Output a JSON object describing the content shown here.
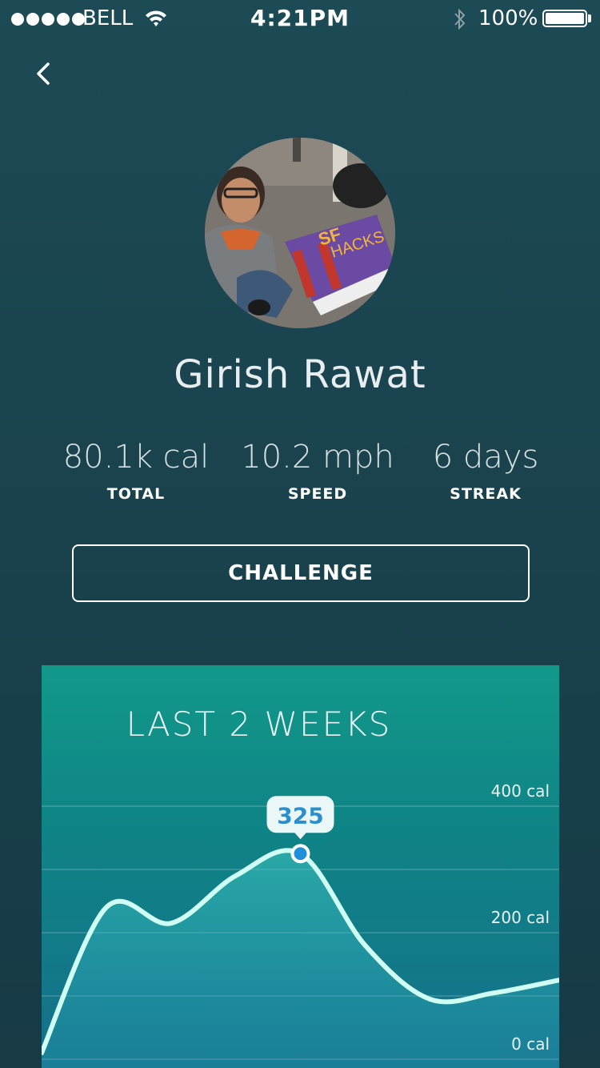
{
  "status_bar": {
    "carrier": "BELL",
    "time": "4:21PM",
    "battery": "100%"
  },
  "profile": {
    "name": "Girish Rawat"
  },
  "stats": [
    {
      "value": "80.1k cal",
      "label": "TOTAL"
    },
    {
      "value": "10.2 mph",
      "label": "SPEED"
    },
    {
      "value": "6 days",
      "label": "STREAK"
    }
  ],
  "actions": {
    "challenge_label": "CHALLENGE"
  },
  "chart_data": {
    "type": "area",
    "title": "LAST 2 WEEKS",
    "y_ticks": [
      "400 cal",
      "200 cal",
      "0 cal"
    ],
    "ylim": [
      0,
      400
    ],
    "x": [
      0,
      1,
      2,
      3,
      4,
      5,
      6,
      7,
      8
    ],
    "values": [
      10,
      240,
      215,
      290,
      325,
      180,
      95,
      105,
      125
    ],
    "highlight": {
      "index": 4,
      "label": "325"
    },
    "line_color": "#cffff3",
    "marker_color": "#1e8fd9"
  }
}
